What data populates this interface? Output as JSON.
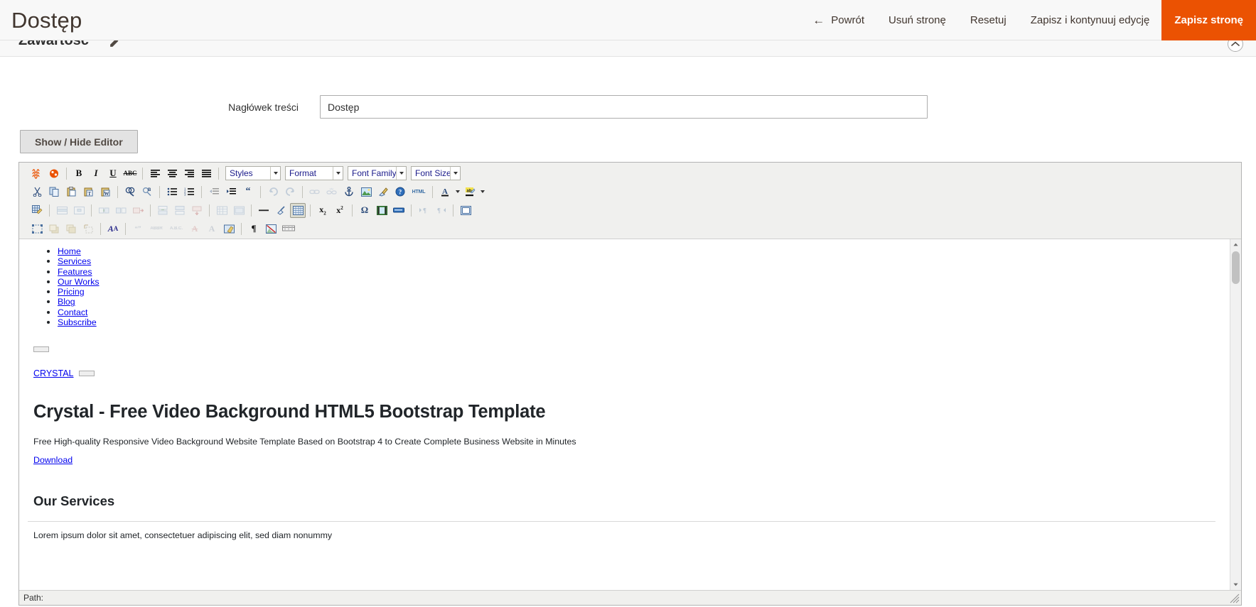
{
  "header": {
    "title": "Dostęp",
    "actions": [
      {
        "label": "Powrót",
        "icon": "arrow-left-icon",
        "glyph": "←",
        "primary": false
      },
      {
        "label": "Usuń stronę",
        "primary": false
      },
      {
        "label": "Resetuj",
        "primary": false
      },
      {
        "label": "Zapisz i kontynuuj edycję",
        "primary": false
      },
      {
        "label": "Zapisz stronę",
        "primary": true
      }
    ],
    "accent_color": "#eb5202"
  },
  "section": {
    "title": "Zawartość",
    "edit_icon": "pencil-icon",
    "collapse_icon": "chevron-up-icon"
  },
  "form": {
    "content_heading_label": "Nagłówek treści",
    "content_heading_value": "Dostęp",
    "content_heading_placeholder": ""
  },
  "editor": {
    "toggle_label": "Show / Hide Editor",
    "selects": [
      {
        "name": "styles",
        "value": "Styles"
      },
      {
        "name": "format",
        "value": "Format"
      },
      {
        "name": "font-family",
        "value": "Font Family"
      },
      {
        "name": "font-size",
        "value": "Font Size"
      }
    ],
    "statusbar_label": "Path:",
    "rows": [
      {
        "name": "toolbar-row-1",
        "buttons": [
          "magento-variable-icon",
          "magento-widget-icon",
          "bold-icon",
          "italic-icon",
          "underline-icon",
          "strikethrough-icon",
          "align-left-icon",
          "align-center-icon",
          "align-right-icon",
          "align-justify-icon"
        ]
      },
      {
        "name": "toolbar-row-2",
        "buttons": [
          "cut-icon",
          "copy-icon",
          "paste-icon",
          "paste-text-icon",
          "paste-word-icon",
          "search-icon",
          "replace-icon",
          "bullet-list-icon",
          "numbered-list-icon",
          "outdent-icon",
          "indent-icon",
          "blockquote-icon",
          "undo-icon",
          "redo-icon",
          "link-icon",
          "unlink-icon",
          "anchor-icon",
          "image-icon",
          "cleanup-icon",
          "help-icon",
          "html-source-icon",
          "forecolor-icon",
          "backcolor-icon"
        ]
      },
      {
        "name": "toolbar-row-3",
        "buttons": [
          "table-icon",
          "table-row-props-icon",
          "table-cell-props-icon",
          "insert-col-before-icon",
          "insert-col-after-icon",
          "delete-col-icon",
          "insert-row-before-icon",
          "insert-row-after-icon",
          "delete-row-icon",
          "split-cells-icon",
          "merge-cells-icon",
          "horizontal-rule-icon",
          "remove-format-icon",
          "visual-aid-icon",
          "subscript-icon",
          "superscript-icon",
          "special-char-icon",
          "media-icon",
          "page-break-icon",
          "ltr-icon",
          "rtl-icon",
          "fullscreen-icon"
        ]
      },
      {
        "name": "toolbar-row-4",
        "buttons": [
          "insert-layer-icon",
          "move-forward-icon",
          "move-backward-icon",
          "absolute-icon",
          "style-props-icon",
          "cite-icon",
          "abbr-icon",
          "acronym-icon",
          "del-icon",
          "ins-icon",
          "attributes-icon",
          "pilcrow-icon",
          "no-image-icon",
          "insert-date-icon"
        ]
      }
    ]
  },
  "document": {
    "nav_links": [
      "Home",
      "Services",
      "Features",
      "Our Works",
      "Pricing",
      "Blog",
      "Contact",
      "Subscribe"
    ],
    "brand": "CRYSTAL",
    "heading": "Crystal - Free Video Background HTML5 Bootstrap Template",
    "lead": "Free High-quality Responsive Video Background Website Template Based on Bootstrap 4 to Create Complete Business Website in Minutes",
    "download_label": "Download",
    "services_heading": "Our Services",
    "services_text": "Lorem ipsum dolor sit amet, consectetuer adipiscing elit, sed diam nonummy",
    "link_color": "#0000ee"
  }
}
